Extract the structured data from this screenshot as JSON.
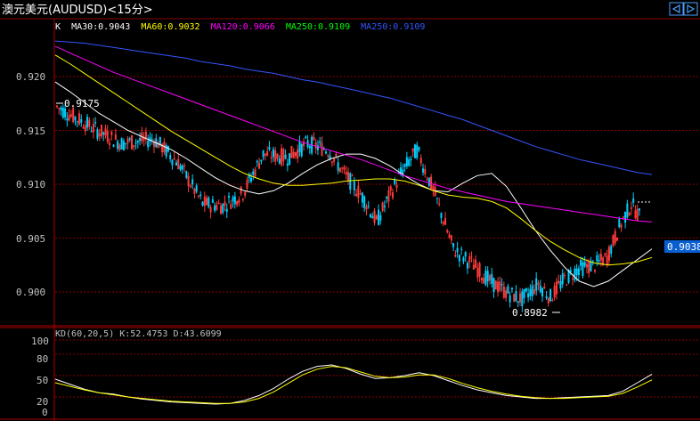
{
  "window": {
    "title": "澳元美元(AUDUSD)<15分>",
    "nav_back_icon": "nav-back-icon",
    "nav_forward_icon": "nav-forward-icon"
  },
  "legend": {
    "prefix": "K",
    "items": [
      {
        "label": "MA30:0.9043",
        "color": "#ffffff"
      },
      {
        "label": "MA60:0.9032",
        "color": "#ffff00"
      },
      {
        "label": "MA120:0.9066",
        "color": "#ff00ff"
      },
      {
        "label": "MA250:0.9109",
        "color": "#00ff00"
      },
      {
        "label": "MA250:0.9109",
        "color": "#3355ff"
      }
    ]
  },
  "price_panel": {
    "yticks": [
      "0.920",
      "0.915",
      "0.910",
      "0.905",
      "0.900"
    ],
    "current_price": "0.9038",
    "high_label": "0.9175",
    "low_label": "0.8982"
  },
  "kd_panel": {
    "legend": "KD(60,20,5) K:52.4753 D:43.6099",
    "yticks": [
      "100",
      "80",
      "50",
      "20",
      "0"
    ]
  },
  "chart_data": [
    {
      "type": "candlestick",
      "ylim": [
        0.8965,
        0.9235
      ],
      "high_marker": 0.9175,
      "low_marker": 0.8982,
      "last_price": 0.9038,
      "series": [
        {
          "name": "MA30",
          "values": [
            0.9195,
            0.9186,
            0.9176,
            0.9166,
            0.9158,
            0.915,
            0.9144,
            0.9138,
            0.9132,
            0.9124,
            0.9115,
            0.9106,
            0.9099,
            0.9094,
            0.9091,
            0.9094,
            0.9101,
            0.911,
            0.9118,
            0.9124,
            0.9128,
            0.9128,
            0.9124,
            0.9117,
            0.9108,
            0.91,
            0.9094,
            0.9093,
            0.9101,
            0.9108,
            0.911,
            0.9098,
            0.9078,
            0.9057,
            0.9039,
            0.9023,
            0.901,
            0.9005,
            0.901,
            0.902,
            0.903,
            0.904
          ]
        },
        {
          "name": "MA60",
          "values": [
            0.922,
            0.9212,
            0.9203,
            0.9194,
            0.9185,
            0.9176,
            0.9167,
            0.9158,
            0.9149,
            0.9141,
            0.9133,
            0.9125,
            0.9117,
            0.911,
            0.9105,
            0.9101,
            0.9099,
            0.9099,
            0.91,
            0.9101,
            0.9103,
            0.9104,
            0.9105,
            0.9105,
            0.9103,
            0.9099,
            0.9094,
            0.909,
            0.9088,
            0.9087,
            0.9084,
            0.9078,
            0.9068,
            0.9057,
            0.9047,
            0.9039,
            0.9032,
            0.9027,
            0.9025,
            0.9026,
            0.9028,
            0.9032
          ]
        },
        {
          "name": "MA120",
          "values": [
            0.9228,
            0.9222,
            0.9216,
            0.921,
            0.9204,
            0.9199,
            0.9194,
            0.9189,
            0.9184,
            0.9179,
            0.9174,
            0.9169,
            0.9164,
            0.9159,
            0.9154,
            0.9149,
            0.9144,
            0.9139,
            0.9135,
            0.9131,
            0.9127,
            0.9123,
            0.9118,
            0.9113,
            0.9108,
            0.9104,
            0.91,
            0.9096,
            0.9093,
            0.909,
            0.9087,
            0.9084,
            0.9082,
            0.908,
            0.9078,
            0.9076,
            0.9074,
            0.9072,
            0.907,
            0.9068,
            0.9066,
            0.9065
          ]
        },
        {
          "name": "MA250",
          "values": [
            0.9233,
            0.9232,
            0.9231,
            0.9229,
            0.9227,
            0.9225,
            0.9223,
            0.9221,
            0.9219,
            0.9217,
            0.9214,
            0.9212,
            0.921,
            0.9207,
            0.9205,
            0.9203,
            0.92,
            0.9197,
            0.9195,
            0.9192,
            0.9189,
            0.9186,
            0.9183,
            0.918,
            0.9176,
            0.9172,
            0.9168,
            0.9164,
            0.916,
            0.9155,
            0.915,
            0.9145,
            0.914,
            0.9135,
            0.9131,
            0.9127,
            0.9123,
            0.912,
            0.9117,
            0.9114,
            0.9111,
            0.9109
          ]
        }
      ]
    },
    {
      "type": "line",
      "ylim": [
        0,
        100
      ],
      "series": [
        {
          "name": "K",
          "values": [
            45,
            38,
            31,
            26,
            24,
            20,
            17,
            15,
            13,
            12,
            11,
            10,
            11,
            15,
            22,
            32,
            45,
            56,
            63,
            65,
            60,
            52,
            46,
            47,
            50,
            54,
            50,
            43,
            36,
            30,
            26,
            22,
            20,
            18,
            18,
            19,
            20,
            21,
            22,
            28,
            40,
            52
          ]
        },
        {
          "name": "D",
          "values": [
            40,
            35,
            30,
            26,
            23,
            20,
            18,
            16,
            14,
            13,
            12,
            11,
            11,
            13,
            18,
            27,
            39,
            51,
            59,
            63,
            61,
            55,
            49,
            47,
            48,
            51,
            51,
            46,
            39,
            33,
            28,
            24,
            21,
            19,
            18,
            18,
            19,
            20,
            21,
            25,
            34,
            44
          ]
        }
      ]
    }
  ]
}
